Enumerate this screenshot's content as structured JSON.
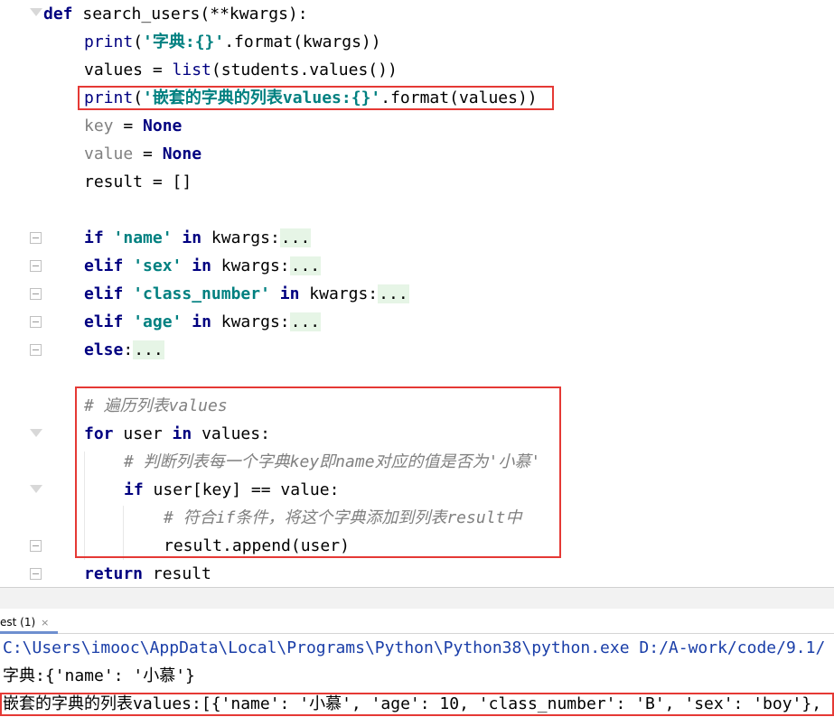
{
  "editor": {
    "l1": {
      "kw": "def",
      "name": " search_users(**kwargs):"
    },
    "l2": {
      "fn": "print",
      "open": "(",
      "str": "'字典:{}'",
      "rest": ".format(kwargs))"
    },
    "l3": {
      "a": "values = ",
      "fn": "list",
      "b": "(students.values())"
    },
    "l4": {
      "fn": "print",
      "open": "(",
      "str": "'嵌套的字典的列表values:{}'",
      "rest": ".format(values))"
    },
    "l5": {
      "var": "key",
      "eq": " = ",
      "val": "None"
    },
    "l6": {
      "var": "value",
      "eq": " = ",
      "val": "None"
    },
    "l7": {
      "text": "result = []"
    },
    "l9": {
      "kw": "if",
      "s": "'name'",
      "in": "in",
      "rest": " kwargs:",
      "dots": "..."
    },
    "l10": {
      "kw": "elif",
      "s": "'sex'",
      "in": "in",
      "rest": " kwargs:",
      "dots": "..."
    },
    "l11": {
      "kw": "elif",
      "s": "'class_number'",
      "in": "in",
      "rest": " kwargs:",
      "dots": "..."
    },
    "l12": {
      "kw": "elif",
      "s": "'age'",
      "in": "in",
      "rest": " kwargs:",
      "dots": "..."
    },
    "l13": {
      "kw": "else",
      "colon": ":",
      "dots": "..."
    },
    "l15": {
      "cmt": "# 遍历列表values"
    },
    "l16": {
      "kw": "for",
      "a": " user ",
      "in": "in",
      "b": " values:"
    },
    "l17": {
      "cmt": "# 判断列表每一个字典key即name对应的值是否为'小慕'"
    },
    "l18": {
      "kw": "if",
      "a": " user[key] == value:"
    },
    "l19": {
      "cmt": "# 符合if条件，将这个字典添加到列表result中"
    },
    "l20": {
      "text": "result.append(user)"
    },
    "l21": {
      "kw": "return",
      "a": " result"
    }
  },
  "run_panel": {
    "tab_label": "est (1)",
    "close_glyph": "×"
  },
  "console": {
    "path_line": "C:\\Users\\imooc\\AppData\\Local\\Programs\\Python\\Python38\\python.exe D:/A-work/code/9.1/",
    "line2": "字典:{'name': '小慕'}",
    "line3": "嵌套的字典的列表values:[{'name': '小慕', 'age': 10, 'class_number': 'B', 'sex': 'boy'},"
  },
  "colors": {
    "highlight_box": "#e53935",
    "keyword": "#000080",
    "string": "#008080",
    "comment": "#808080",
    "folded_bg": "#e6f5e6"
  }
}
